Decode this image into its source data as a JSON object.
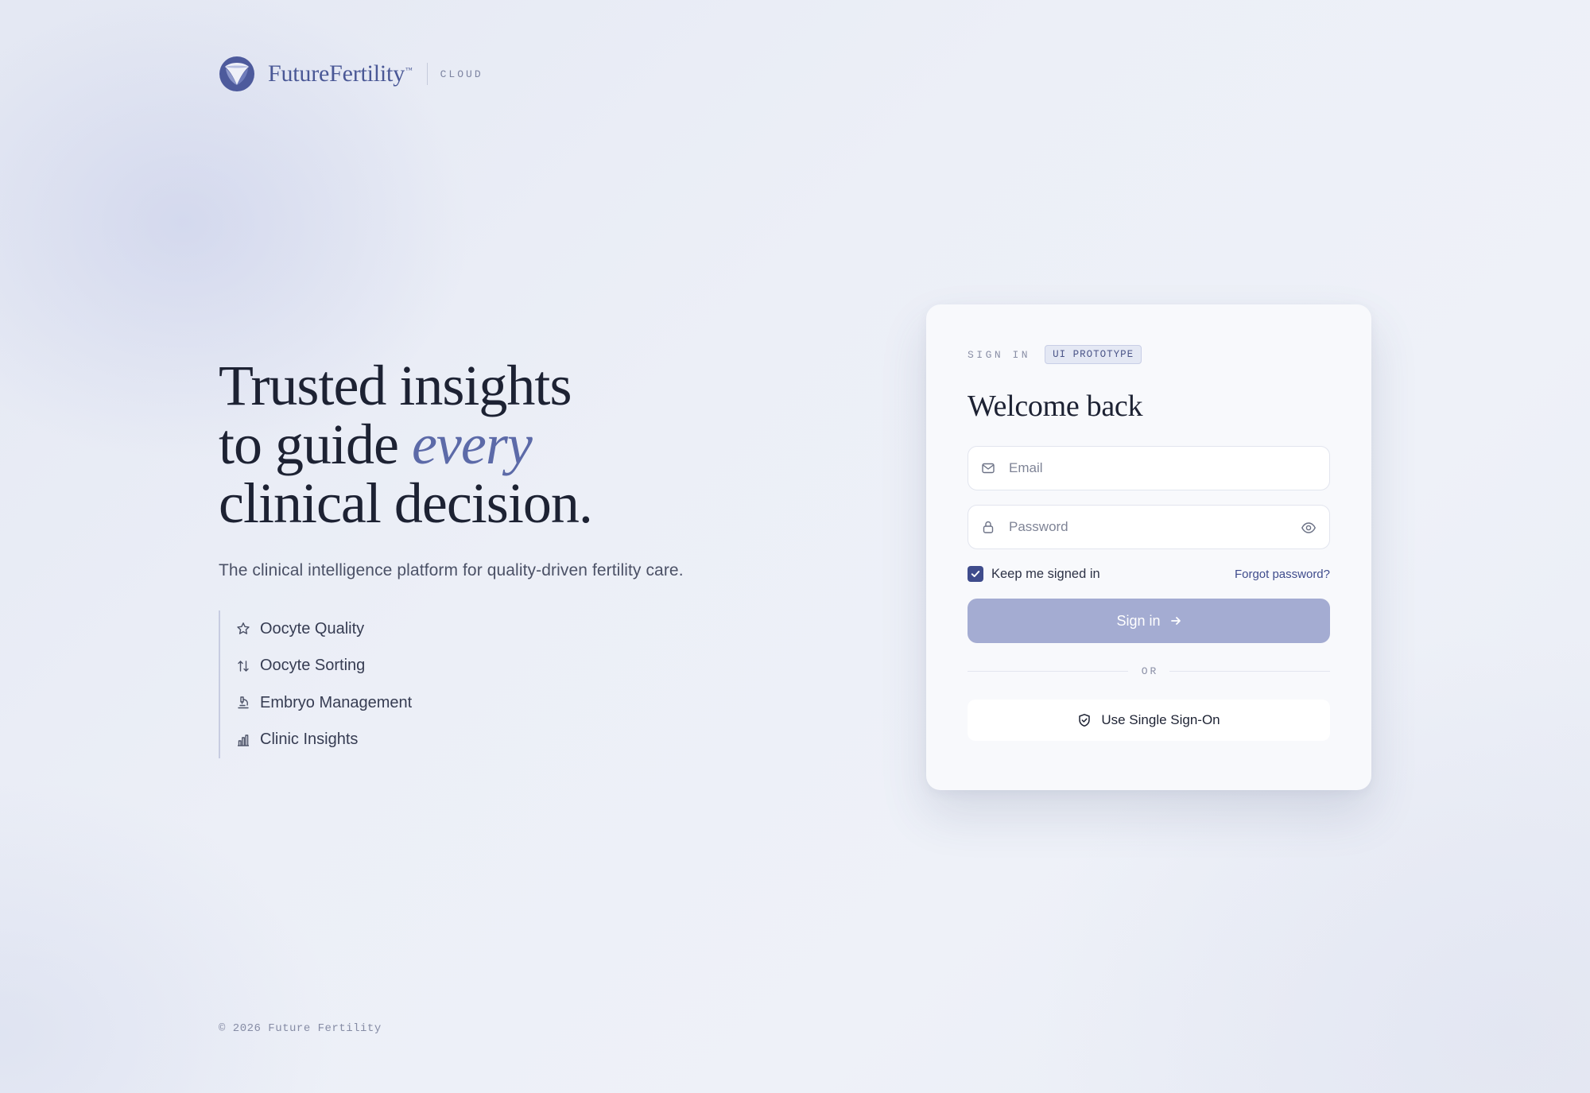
{
  "brand": {
    "name": "FutureFertility",
    "trademark": "™",
    "subtitle": "CLOUD",
    "logo_icon": "triangular-ribbon-logo-icon",
    "accent_color": "#4a5896"
  },
  "hero": {
    "title_line1": "Trusted insights",
    "title_line2_prefix": "to guide ",
    "title_line2_accent": "every",
    "title_line3": "clinical decision.",
    "subtitle": "The clinical intelligence platform for quality-driven fertility care.",
    "features": [
      {
        "icon": "star-icon",
        "label": "Oocyte Quality"
      },
      {
        "icon": "sort-arrows-icon",
        "label": "Oocyte Sorting"
      },
      {
        "icon": "microscope-icon",
        "label": "Embryo Management"
      },
      {
        "icon": "bar-chart-icon",
        "label": "Clinic Insights"
      }
    ]
  },
  "card": {
    "eyebrow": "SIGN IN",
    "badge": "UI PROTOTYPE",
    "title": "Welcome back",
    "email": {
      "placeholder": "Email",
      "value": "",
      "icon": "mail-icon"
    },
    "password": {
      "placeholder": "Password",
      "value": "",
      "icon": "lock-icon",
      "toggle_icon": "eye-icon"
    },
    "remember_label": "Keep me signed in",
    "remember_checked": true,
    "forgot_label": "Forgot password?",
    "signin_label": "Sign in",
    "signin_icon": "arrow-right-icon",
    "divider_text": "OR",
    "sso_label": "Use Single Sign-On",
    "sso_icon": "shield-check-icon"
  },
  "footer": {
    "copyright": "© 2026 Future Fertility"
  },
  "colors": {
    "primary": "#3f4c8c",
    "button_disabled": "#a4acd2",
    "accent_text": "#5c6aa8",
    "text_dark": "#1d2233"
  }
}
